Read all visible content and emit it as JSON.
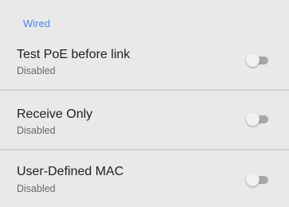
{
  "section": {
    "title": "Wired"
  },
  "settings": [
    {
      "title": "Test PoE before link",
      "subtitle": "Disabled",
      "enabled": false
    },
    {
      "title": "Receive Only",
      "subtitle": "Disabled",
      "enabled": false
    },
    {
      "title": "User-Defined MAC",
      "subtitle": "Disabled",
      "enabled": false
    }
  ]
}
